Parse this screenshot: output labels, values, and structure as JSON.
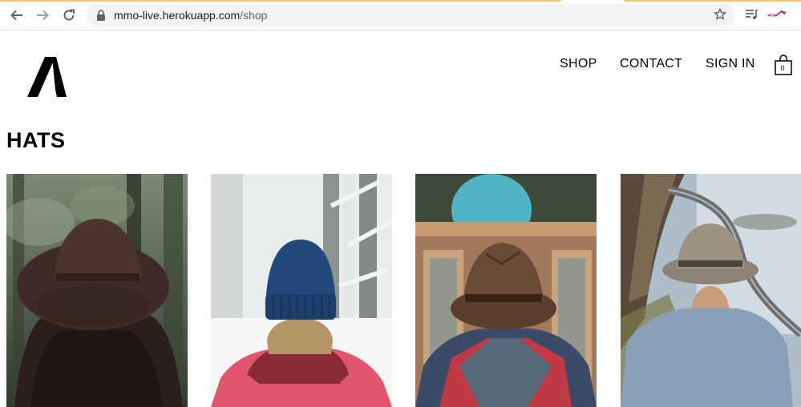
{
  "browser": {
    "url_host": "mmo-live.herokuapp.com",
    "url_path": "/shop"
  },
  "nav": {
    "shop": "SHOP",
    "contact": "CONTACT",
    "sign_in": "SIGN IN",
    "cart_count": "0"
  },
  "page": {
    "title": "HATS"
  },
  "products": [
    {
      "image": "brown-fedora-forest"
    },
    {
      "image": "blue-beanie-snow"
    },
    {
      "image": "brown-cowboy-hat-mosque"
    },
    {
      "image": "grey-hat-coastal-road"
    }
  ]
}
